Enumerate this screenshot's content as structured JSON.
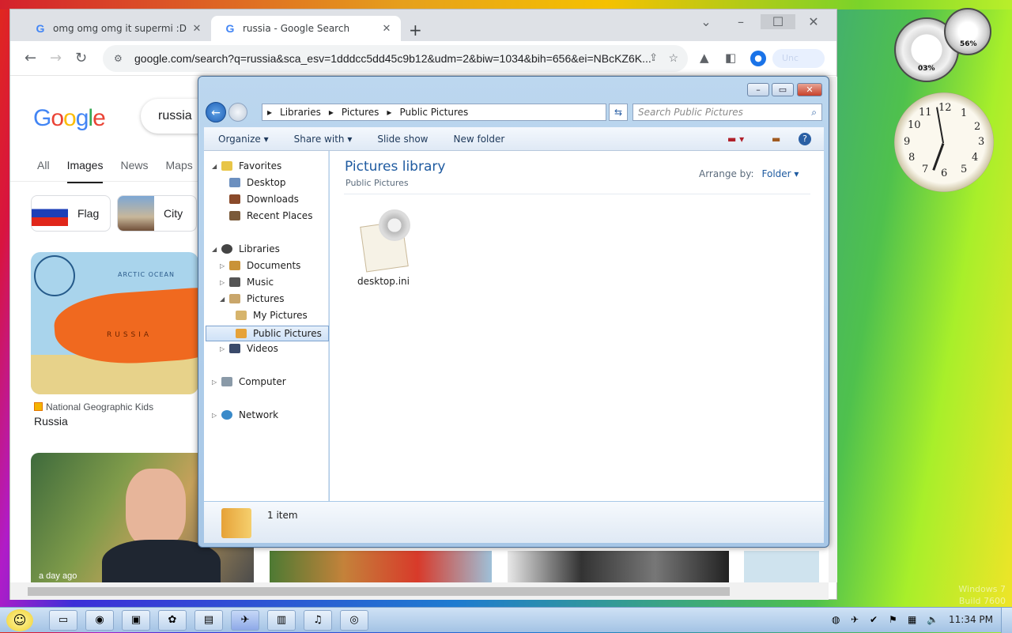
{
  "browser": {
    "tabs": [
      {
        "title": "omg omg omg it supermi :D - G",
        "close": "✕"
      },
      {
        "title": "russia - Google Search",
        "close": "✕"
      }
    ],
    "new_tab": "+",
    "url": "google.com/search?q=russia&sca_esv=1dddcc5dd45c9b12&udm=2&biw=1034&bih=656&ei=NBcKZ6K...",
    "profile_pill": "Unc"
  },
  "google": {
    "logo": [
      "G",
      "o",
      "o",
      "g",
      "l",
      "e"
    ],
    "query": "russia",
    "tabs": [
      "All",
      "Images",
      "News",
      "Maps"
    ],
    "active_tab": "Images",
    "chips": [
      "Flag",
      "City"
    ],
    "map_labels": {
      "ocean": "ARCTIC OCEAN",
      "country": "RUSSIA"
    },
    "result1": {
      "source": "National Geographic Kids",
      "title": "Russia"
    },
    "result2": {
      "badge": "a day ago"
    }
  },
  "explorer": {
    "breadcrumb": [
      "Libraries",
      "Pictures",
      "Public Pictures"
    ],
    "search_placeholder": "Search Public Pictures",
    "commands": [
      "Organize ▾",
      "Share with ▾",
      "Slide show",
      "New folder"
    ],
    "nav": {
      "favorites": "Favorites",
      "desktop": "Desktop",
      "downloads": "Downloads",
      "recent": "Recent Places",
      "libraries": "Libraries",
      "documents": "Documents",
      "music": "Music",
      "pictures": "Pictures",
      "my_pictures": "My Pictures",
      "public_pictures": "Public Pictures",
      "videos": "Videos",
      "computer": "Computer",
      "network": "Network"
    },
    "library_title": "Pictures library",
    "library_sub": "Public Pictures",
    "arrange_label": "Arrange by:",
    "arrange_value": "Folder ▾",
    "files": [
      {
        "name": "desktop.ini"
      }
    ],
    "item_count": "1 item"
  },
  "gadgets": {
    "cpu_pct": "03%",
    "mem_pct": "56%",
    "clock_numbers": [
      "12",
      "1",
      "2",
      "3",
      "4",
      "5",
      "6",
      "7",
      "8",
      "9",
      "10",
      "11"
    ]
  },
  "watermark": [
    "Windows 7",
    "Build 7600"
  ],
  "taskbar": {
    "time": "11:34 PM"
  },
  "colors": {
    "google_blue": "#4285f4",
    "explorer_link": "#1e5aa0",
    "selection": "#cfe2f7"
  }
}
